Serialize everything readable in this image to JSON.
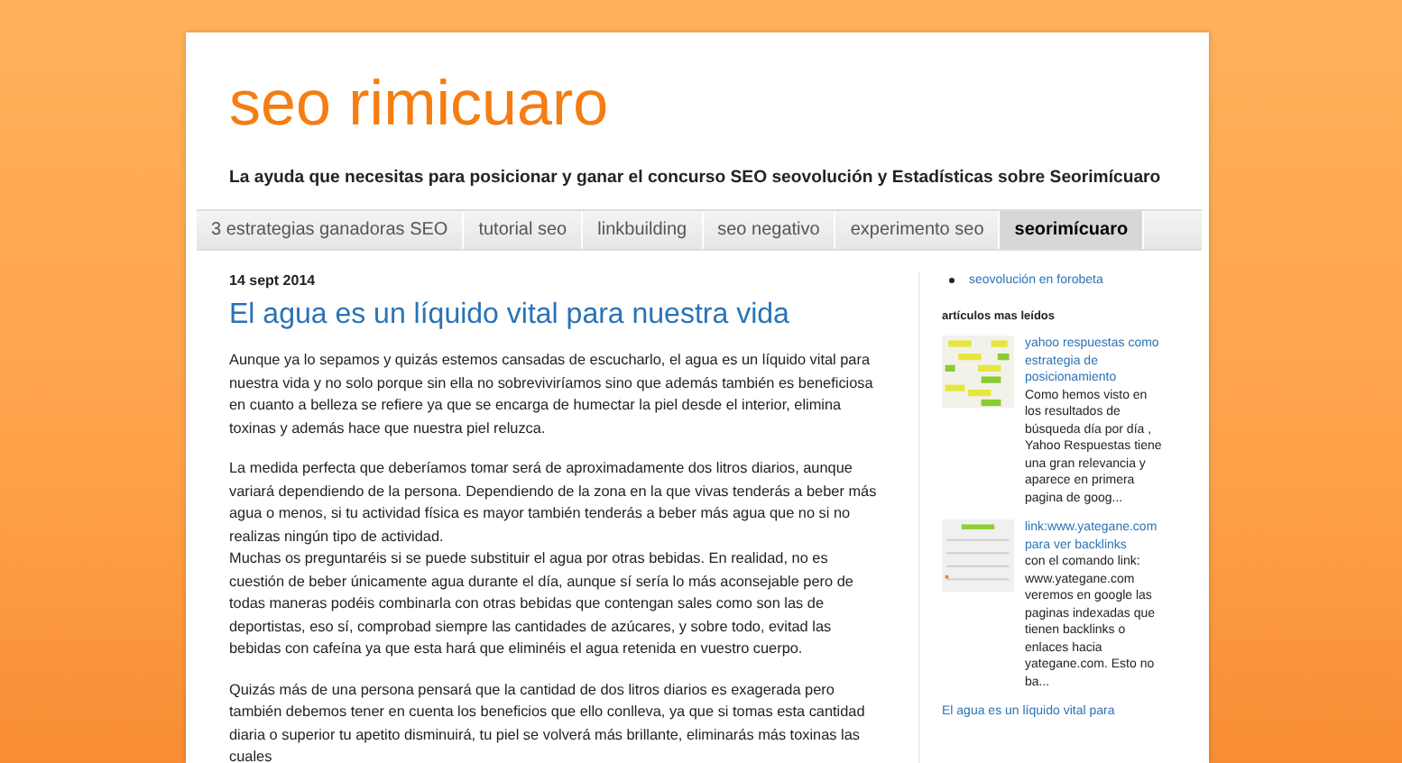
{
  "header": {
    "title": "seo rimicuaro",
    "description": "La ayuda que necesitas para posicionar y ganar el concurso SEO seovolución y Estadísticas sobre Seorimícuaro"
  },
  "tabs": [
    {
      "label": "3 estrategias ganadoras SEO",
      "selected": false
    },
    {
      "label": "tutorial seo",
      "selected": false
    },
    {
      "label": "linkbuilding",
      "selected": false
    },
    {
      "label": "seo negativo",
      "selected": false
    },
    {
      "label": "experimento seo",
      "selected": false
    },
    {
      "label": "seorimícuaro",
      "selected": true
    }
  ],
  "post": {
    "date": "14 sept 2014",
    "title": "El agua es un líquido vital para nuestra vida",
    "paragraphs": [
      [
        "Aunque ya lo sepamos y quizás estemos cansadas de escucharlo, el agua es un líquido vital para nuestra vida y no solo porque sin ella no sobreviviríamos sino que además también es beneficiosa en cuanto a belleza se refiere ya que se encarga de humectar la piel desde el interior, elimina toxinas y además hace que nuestra piel reluzca."
      ],
      [
        "La medida perfecta que deberíamos tomar será de aproximadamente dos litros diarios, aunque variará dependiendo de la persona. Dependiendo de la zona en la que vivas tenderás a beber más agua o menos, si tu actividad física es mayor también tenderás a beber más agua que no si no realizas ningún tipo de actividad.",
        "Muchas os preguntaréis si se puede substituir el agua por otras bebidas. En realidad, no es cuestión de beber únicamente agua durante el día, aunque sí sería lo más aconsejable pero de todas maneras podéis combinarla con otras bebidas que contengan sales como son las de deportistas, eso sí, comprobad siempre las cantidades de azúcares, y sobre todo, evitad las bebidas con cafeína ya que esta hará que eliminéis el agua retenida en vuestro cuerpo."
      ],
      [
        "Quizás más de una persona pensará que la cantidad de dos litros diarios es exagerada pero también debemos tener en cuenta los beneficios que ello conlleva, ya que si tomas esta cantidad diaria o superior tu apetito disminuirá, tu piel se volverá más brillante, eliminarás más toxinas las cuales"
      ]
    ]
  },
  "sidebar": {
    "links": [
      "seovolución en forobeta"
    ],
    "popular_heading": "artículos mas leídos",
    "popular": [
      {
        "kind": "diagram",
        "title": "yahoo respuestas como estrategia de posicionamiento",
        "snippet": "Como hemos visto en los resultados de búsqueda día por día , Yahoo Respuestas tiene una gran relevancia y aparece en primera pagina de goog..."
      },
      {
        "kind": "page",
        "title": "link:www.yategane.com para ver backlinks",
        "snippet": "con el comando link: www.yategane.com veremos en google las paginas indexadas que tienen backlinks o enlaces hacia yategane.com. Esto no ba..."
      },
      {
        "kind": "none",
        "title": "El agua es un líquido vital para"
      }
    ]
  }
}
